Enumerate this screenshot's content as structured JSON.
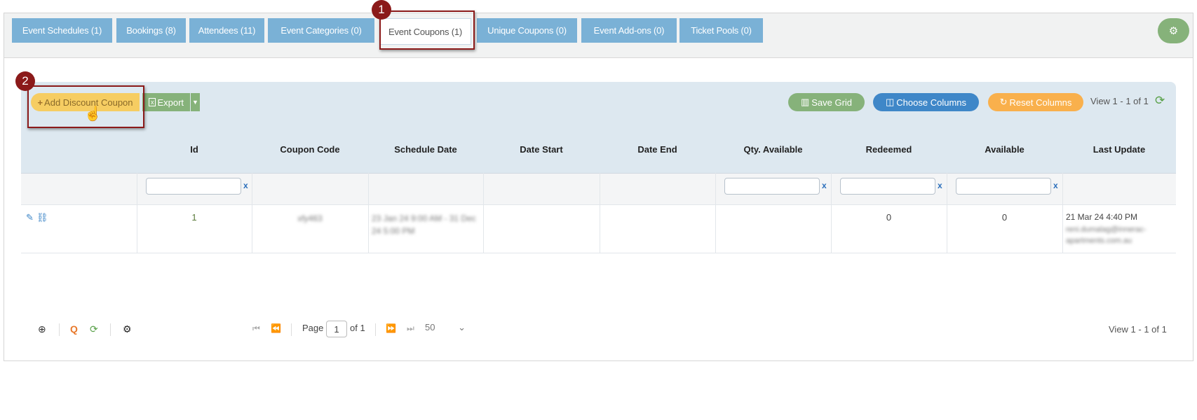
{
  "tabs": [
    {
      "label": "Event Schedules (1)"
    },
    {
      "label": "Bookings (8)"
    },
    {
      "label": "Attendees (11)"
    },
    {
      "label": "Event Categories (0)"
    },
    {
      "label": "Event Coupons (1)",
      "active": true
    },
    {
      "label": "Unique Coupons (0)"
    },
    {
      "label": "Event Add-ons (0)"
    },
    {
      "label": "Ticket Pools (0)"
    }
  ],
  "toolbar": {
    "add_label": "Add Discount Coupon",
    "export_label": "Export",
    "save_grid_label": "Save Grid",
    "choose_columns_label": "Choose Columns",
    "reset_columns_label": "Reset Columns",
    "view_text": "View 1 - 1 of 1"
  },
  "columns": [
    "Id",
    "Coupon Code",
    "Schedule Date",
    "Date Start",
    "Date End",
    "Qty. Available",
    "Redeemed",
    "Available",
    "Last Update"
  ],
  "filter_clear": "x",
  "rows": [
    {
      "id": "1",
      "coupon_code": "xfy463",
      "schedule_date": "23 Jan 24 9:00 AM - 31 Dec 24 5:00 PM",
      "date_start": "",
      "date_end": "",
      "qty_available": "",
      "redeemed": "0",
      "available": "0",
      "last_update": "21 Mar 24 4:40 PM",
      "last_update_by": "reni.dumalag@innerac-apartments.com.au"
    }
  ],
  "footer": {
    "page_label": "Page",
    "page_value": "1",
    "of_label": "of 1",
    "page_size": "50",
    "view_text": "View 1 - 1 of 1"
  },
  "annotations": [
    "1",
    "2"
  ],
  "colors": {
    "tab": "#7ab1d6",
    "green": "#86b27a",
    "blue": "#3f87c8",
    "orange": "#f9b04c",
    "yellow": "#f6cd62",
    "annotation": "#8b1a1a"
  }
}
